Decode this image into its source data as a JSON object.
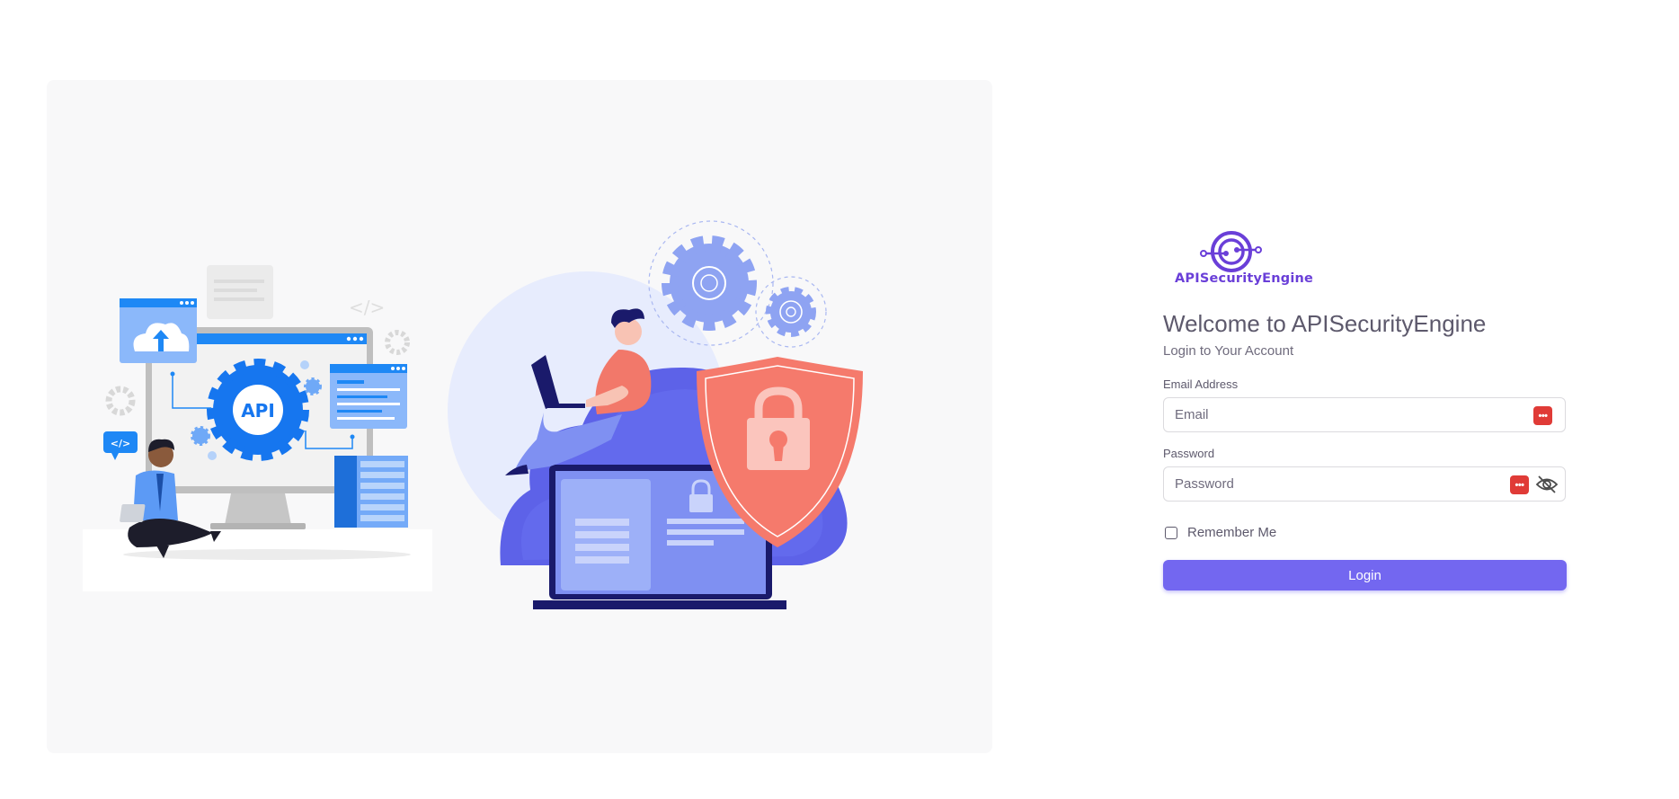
{
  "brand": {
    "name": "APISecurityEngine",
    "accent": "#7367f0"
  },
  "illustration": {
    "api_label": "API",
    "code_tag": "</>"
  },
  "auth": {
    "welcome": "Welcome to APISecurityEngine",
    "subtitle": "Login to Your Account",
    "email_label": "Email Address",
    "email_placeholder": "Email",
    "email_value": "",
    "password_label": "Password",
    "password_placeholder": "Password",
    "password_value": "",
    "remember_label": "Remember Me",
    "remember_checked": false,
    "login_label": "Login",
    "icons": {
      "password_manager": "password-manager-icon",
      "toggle_visibility": "eye-slash-icon"
    }
  }
}
